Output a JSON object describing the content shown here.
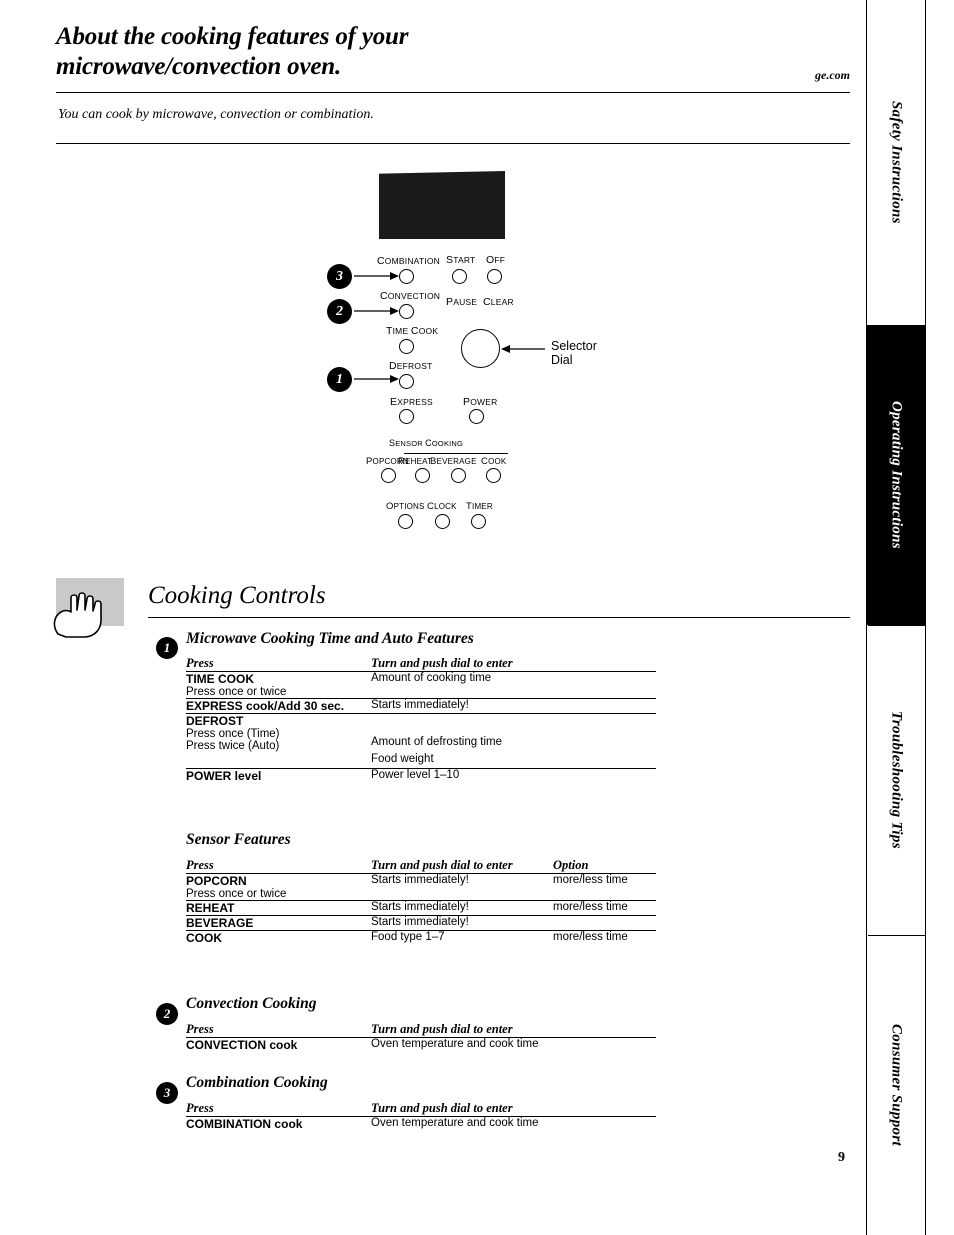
{
  "header": {
    "title_line1": "About the cooking features of your",
    "title_line2": "microwave/convection oven.",
    "site": "ge.com",
    "subhead": "You can cook by microwave, convection or combination."
  },
  "side_tabs": [
    {
      "label": "Safety Instructions",
      "style": "white"
    },
    {
      "label": "Operating Instructions",
      "style": "black"
    },
    {
      "label": "Troubleshooting Tips",
      "style": "white"
    },
    {
      "label": "Consumer Support",
      "style": "white"
    }
  ],
  "panel": {
    "selector_dial_label": "Selector Dial",
    "callouts": [
      "3",
      "2",
      "1"
    ],
    "buttons": [
      {
        "label": "Combination"
      },
      {
        "label": "Start",
        "sub": "Pause"
      },
      {
        "label": "Off",
        "sub": "Clear"
      },
      {
        "label": "Convection"
      },
      {
        "label": "Time Cook"
      },
      {
        "label": "Defrost"
      },
      {
        "label": "Express"
      },
      {
        "label": "Power"
      }
    ],
    "sensor_group_label": "Sensor Cooking",
    "sensor_buttons": [
      "Popcorn",
      "Reheat",
      "Beverage",
      "Cook"
    ],
    "bottom_buttons": [
      "Options",
      "Clock",
      "Timer"
    ]
  },
  "cooking_controls": {
    "title": "Cooking Controls",
    "sections": [
      {
        "badge": "1",
        "title": "Microwave Cooking Time and Auto Features",
        "headers": [
          "Press",
          "Turn and push dial to enter"
        ],
        "rows": [
          {
            "press": "TIME COOK",
            "press_sub": "Press once or twice",
            "enter": "Amount of cooking time"
          },
          {
            "press": "EXPRESS cook/Add 30 sec.",
            "press_sub": "",
            "enter": "Starts immediately!"
          },
          {
            "press": "DEFROST",
            "press_sub": "Press once (Time)\nPress twice (Auto)",
            "enter": "Amount of defrosting time\nFood weight"
          },
          {
            "press": "POWER level",
            "press_sub": "",
            "enter": "Power level 1–10"
          }
        ]
      },
      {
        "badge": "",
        "title": "Sensor Features",
        "headers": [
          "Press",
          "Turn and push dial to enter",
          "Option"
        ],
        "rows": [
          {
            "press": "POPCORN",
            "press_sub": "Press once or twice",
            "enter": "Starts immediately!",
            "option": "more/less time"
          },
          {
            "press": "REHEAT",
            "press_sub": "",
            "enter": "Starts immediately!",
            "option": "more/less time"
          },
          {
            "press": "BEVERAGE",
            "press_sub": "",
            "enter": "Starts immediately!",
            "option": ""
          },
          {
            "press": "COOK",
            "press_sub": "",
            "enter": "Food type 1–7",
            "option": "more/less time"
          }
        ]
      },
      {
        "badge": "2",
        "title": "Convection Cooking",
        "headers": [
          "Press",
          "Turn and push dial to enter"
        ],
        "rows": [
          {
            "press": "CONVECTION cook",
            "press_sub": "",
            "enter": "Oven temperature and cook time"
          }
        ]
      },
      {
        "badge": "3",
        "title": "Combination Cooking",
        "headers": [
          "Press",
          "Turn and push dial to enter"
        ],
        "rows": [
          {
            "press": "COMBINATION cook",
            "press_sub": "",
            "enter": "Oven temperature and cook time"
          }
        ]
      }
    ]
  },
  "page_number": "9"
}
